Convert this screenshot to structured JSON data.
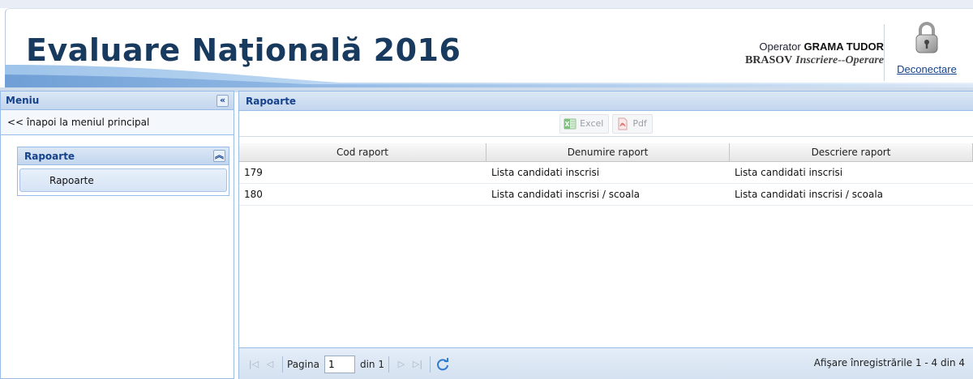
{
  "header": {
    "title": "Evaluare Naţională 2016",
    "operator_label": "Operator",
    "operator_name": "GRAMA TUDOR",
    "county": "BRASOV",
    "role": "Inscriere--Operare",
    "logout_label": "Deconectare",
    "logout_icon": "lock-icon"
  },
  "sidebar": {
    "title": "Meniu",
    "collapse_icon": "double-chevron-left-icon",
    "back_link": "<< înapoi la meniul principal",
    "group": {
      "title": "Rapoarte",
      "collapse_icon": "double-chevron-up-icon",
      "items": [
        {
          "label": "Rapoarte"
        }
      ]
    }
  },
  "main": {
    "title": "Rapoarte",
    "toolbar": {
      "excel_label": "Excel",
      "pdf_label": "Pdf"
    },
    "grid": {
      "columns": [
        "Cod raport",
        "Denumire raport",
        "Descriere raport"
      ],
      "rows": [
        {
          "code": "179",
          "name": "Lista candidati inscrisi",
          "description": "Lista candidati inscrisi"
        },
        {
          "code": "180",
          "name": "Lista candidati inscrisi / scoala",
          "description": "Lista candidati inscrisi / scoala"
        }
      ]
    },
    "pager": {
      "page_label": "Pagina",
      "page_value": "1",
      "of_label": "din 1",
      "status": "Afişare înregistrările 1 - 4 din 4"
    }
  },
  "colors": {
    "title": "#183a5e",
    "panel_header_text": "#15428b",
    "panel_border": "#99bbe8",
    "link": "#15428b"
  }
}
